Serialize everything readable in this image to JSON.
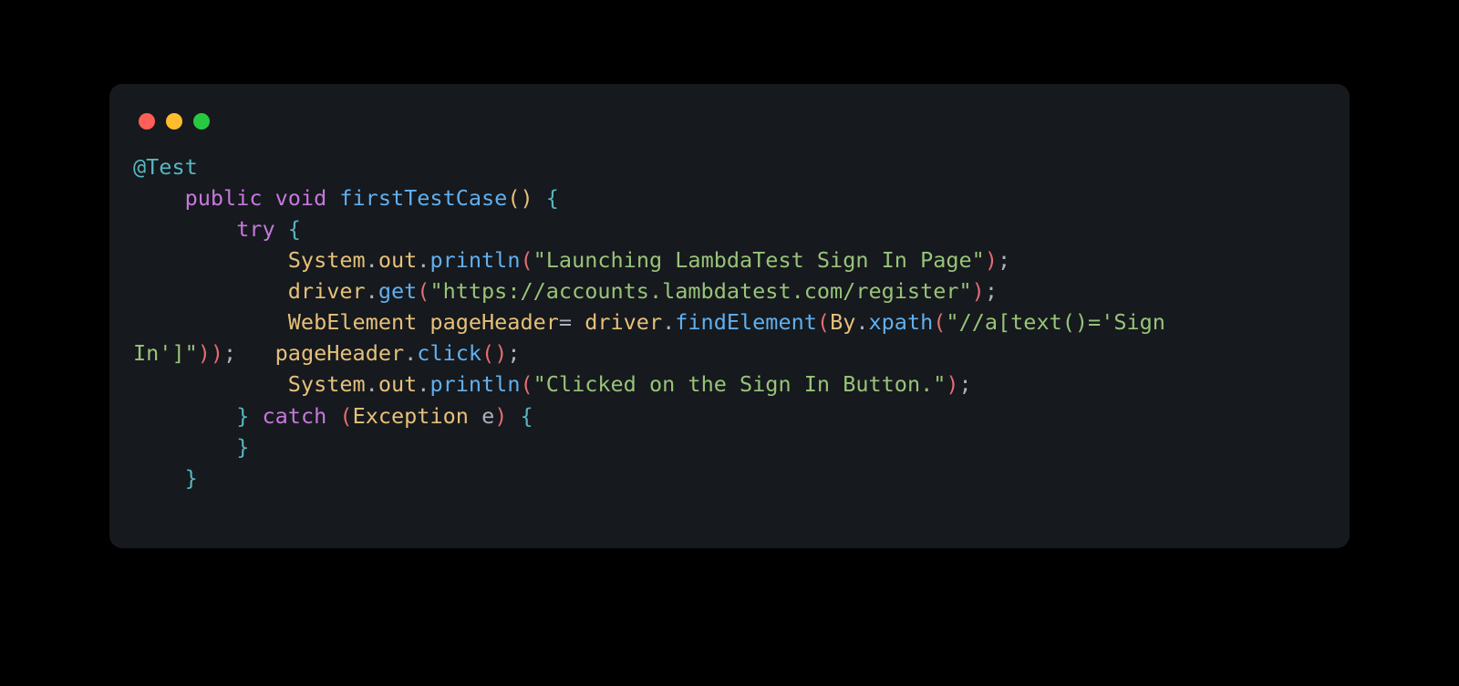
{
  "colors": {
    "bg": "#16191d",
    "red": "#ff5f56",
    "yellow": "#ffbd2e",
    "green": "#27c93f"
  },
  "code": {
    "annotation": "@Test",
    "kw_public": "public",
    "kw_void": "void",
    "fn_name": "firstTestCase",
    "parens1": "()",
    "brace_open": "{",
    "kw_try": "try",
    "brace_open2": "{",
    "l1_obj": "System",
    "l1_dot1": ".",
    "l1_out": "out",
    "l1_dot2": ".",
    "l1_println": "println",
    "l1_po": "(",
    "l1_str": "\"Launching LambdaTest Sign In Page\"",
    "l1_pc": ")",
    "l1_semi": ";",
    "l2_driver": "driver",
    "l2_dot": ".",
    "l2_get": "get",
    "l2_po": "(",
    "l2_str": "\"https://accounts.lambdatest.com/register\"",
    "l2_pc": ")",
    "l2_semi": ";",
    "l3_type": "WebElement",
    "l3_var": "pageHeader",
    "l3_eq": "=",
    "l3_driver": "driver",
    "l3_dot": ".",
    "l3_find": "findElement",
    "l3_po": "(",
    "l3_by": "By",
    "l3_dot2": ".",
    "l3_xpath": "xpath",
    "l3_po2": "(",
    "l3_str": "\"//a[text()='Sign \nIn']\"",
    "l3_pc": "))",
    "l3_semi": ";",
    "l4_var": "pageHeader",
    "l4_dot": ".",
    "l4_click": "click",
    "l4_po": "()",
    "l4_semi": ";",
    "l5_obj": "System",
    "l5_dot1": ".",
    "l5_out": "out",
    "l5_dot2": ".",
    "l5_println": "println",
    "l5_po": "(",
    "l5_str": "\"Clicked on the Sign In Button.\"",
    "l5_pc": ")",
    "l5_semi": ";",
    "brace_close2": "}",
    "kw_catch": "catch",
    "catch_po": "(",
    "exc_type": "Exception",
    "exc_var": "e",
    "catch_pc": ")",
    "brace_open3": "{",
    "brace_close3": "}",
    "brace_close": "}"
  }
}
